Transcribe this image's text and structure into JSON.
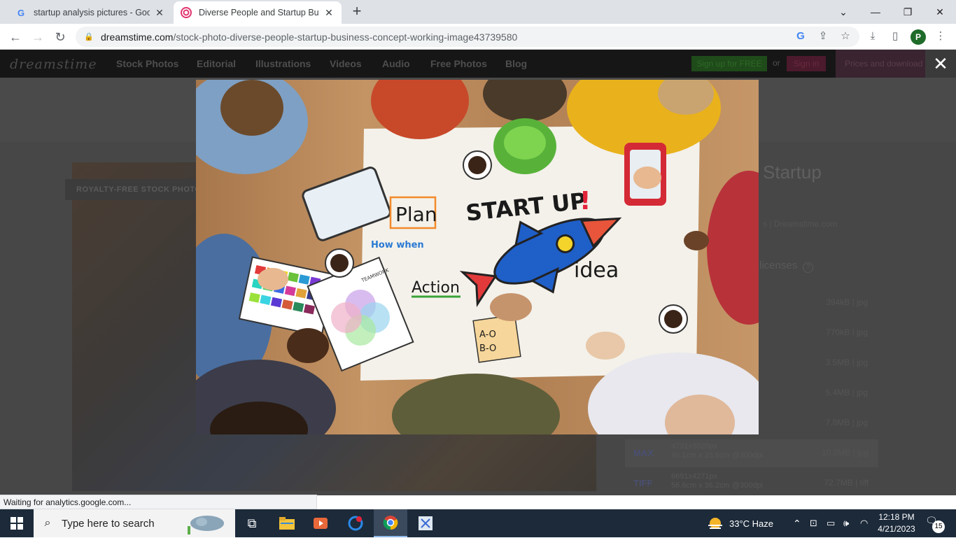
{
  "browser": {
    "tabs": [
      {
        "title": "startup analysis pictures - Google",
        "icon": "google-icon"
      },
      {
        "title": "Diverse People and Startup Busin",
        "icon": "dreamstime-icon"
      }
    ],
    "url_host": "dreamstime.com",
    "url_path": "/stock-photo-diverse-people-startup-business-concept-working-image43739580",
    "profile_initial": "P",
    "status": "Waiting for analytics.google.com..."
  },
  "site": {
    "logo": "dreamstime",
    "nav": [
      "Stock Photos",
      "Editorial",
      "Illustrations",
      "Videos",
      "Audio",
      "Free Photos",
      "Blog"
    ],
    "signup": "Sign up for FREE",
    "or": "or",
    "signin": "Sign in",
    "prices": "Prices and download plans",
    "royalty_free": "ROYALTY-FREE STOCK PHOTO",
    "title_fragment": "Startup",
    "credit_fragment": "s | Dreamstime.com",
    "licenses_fragment": "licenses",
    "sizes": [
      {
        "file": "394kB | jpg"
      },
      {
        "file": "770kB | jpg"
      },
      {
        "file": "3.5MB | jpg"
      },
      {
        "file": "5.4MB | jpg"
      },
      {
        "file": "7.8MB | jpg"
      },
      {
        "label": "MAX",
        "dims1": "4731x3020px",
        "dims2": "40.1cm x 25.6cm @300dpi",
        "file": "10.2MB | jpg"
      },
      {
        "label": "TIFF",
        "dims1": "6691x4271px",
        "dims2": "56.6cm x 36.2cm @300dpi",
        "file": "72.7MB | tiff"
      }
    ]
  },
  "lightbox": {
    "close": "✕",
    "image_text": {
      "startup": "START UP",
      "exclaim": "!",
      "plan": "Plan",
      "how_when": "How  when",
      "action": "Action",
      "idea": "idea",
      "teamwork": "TEAMWORK",
      "ab": "A-O",
      "bo": "B-O"
    }
  },
  "taskbar": {
    "search_placeholder": "Type here to search",
    "weather": "33°C  Haze",
    "time": "12:18 PM",
    "date": "4/21/2023",
    "notifications": "15"
  }
}
